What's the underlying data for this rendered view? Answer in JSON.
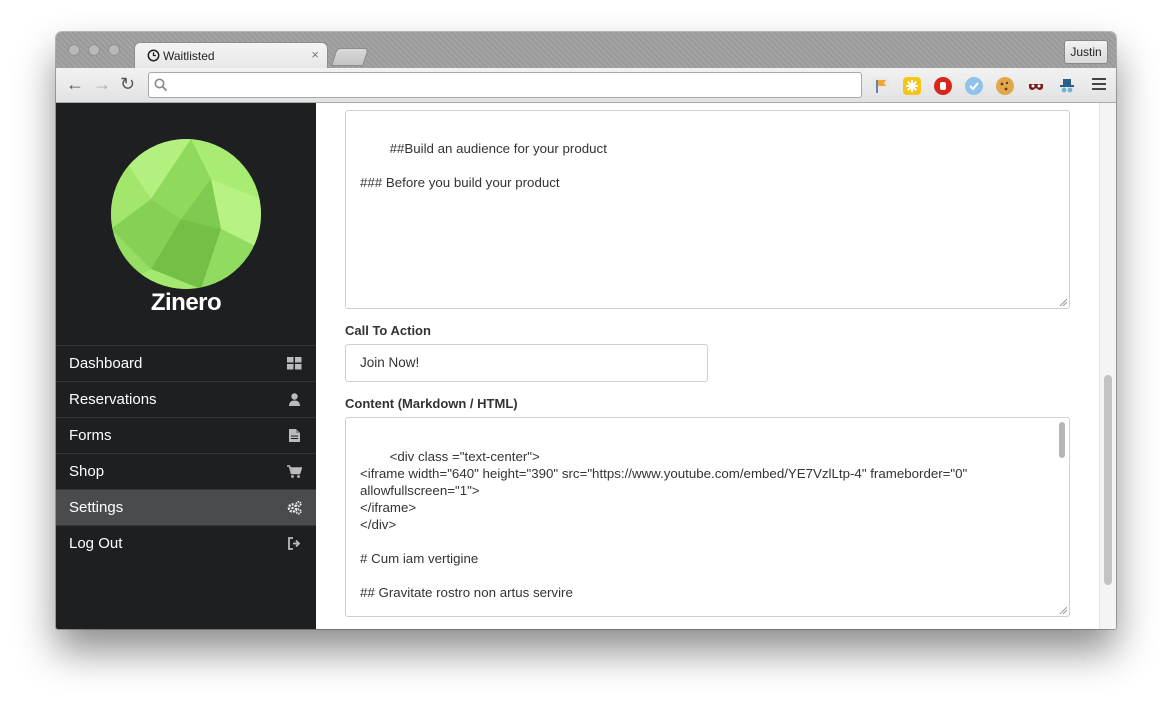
{
  "browser": {
    "tab_title": "Waitlisted",
    "tab_close": "×",
    "profile_name": "Justin",
    "address_value": "",
    "back_glyph": "←",
    "forward_glyph": "→",
    "reload_glyph": "↻",
    "extensions": [
      "flag-icon",
      "star-icon",
      "stop-hand-icon",
      "checkmark-icon",
      "cookie-icon",
      "mask-icon",
      "spy-icon"
    ]
  },
  "sidebar": {
    "brand": "Zinero",
    "items": [
      {
        "label": "Dashboard",
        "icon": "grid-icon"
      },
      {
        "label": "Reservations",
        "icon": "user-icon"
      },
      {
        "label": "Forms",
        "icon": "document-icon"
      },
      {
        "label": "Shop",
        "icon": "cart-icon"
      },
      {
        "label": "Settings",
        "icon": "gears-icon",
        "active": true
      },
      {
        "label": "Log Out",
        "icon": "logout-icon"
      }
    ]
  },
  "main": {
    "description_text": "##Build an audience for your product\n\n### Before you build your product",
    "cta_label": "Call To Action",
    "cta_value": "Join Now!",
    "content_label": "Content (Markdown / HTML)",
    "content_text": "<div class =\"text-center\">\n<iframe width=\"640\" height=\"390\" src=\"https://www.youtube.com/embed/YE7VzlLtp-4\" frameborder=\"0\"\nallowfullscreen=\"1\">\n</iframe>\n</div>\n\n# Cum iam vertigine\n\n## Gravitate rostro non artus servire\n\nLorem markdownum, nimium et citius [rictus"
  },
  "colors": {
    "sidebar_bg": "#1e1f21",
    "sidebar_active": "#4a4b4d",
    "logo_green": "#9be36a"
  }
}
